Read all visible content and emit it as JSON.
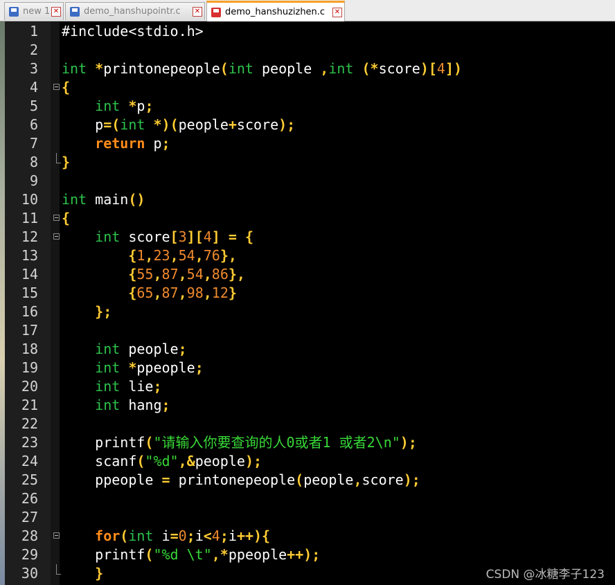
{
  "tabs": [
    {
      "label": "new 1",
      "icon": "save-disk-icon",
      "active": false
    },
    {
      "label": "demo_hanshupointr.c",
      "icon": "save-disk-icon",
      "active": false
    },
    {
      "label": "demo_hanshuzizhen.c",
      "icon": "save-disk-icon",
      "active": true
    }
  ],
  "editor": {
    "lines": [
      {
        "n": "1",
        "fold": "",
        "t": [
          [
            "pl",
            "#include<stdio.h>"
          ]
        ]
      },
      {
        "n": "2",
        "fold": "",
        "t": []
      },
      {
        "n": "3",
        "fold": "",
        "t": [
          [
            "kw",
            "int"
          ],
          [
            "pl",
            " "
          ],
          [
            "op",
            "*"
          ],
          [
            "pl",
            "printonepeople"
          ],
          [
            "op",
            "("
          ],
          [
            "kw",
            "int"
          ],
          [
            "pl",
            " people "
          ],
          [
            "op",
            ","
          ],
          [
            "kw",
            "int"
          ],
          [
            "pl",
            " "
          ],
          [
            "op",
            "(*"
          ],
          [
            "pl",
            "score"
          ],
          [
            "op",
            ")["
          ],
          [
            "num",
            "4"
          ],
          [
            "op",
            "])"
          ]
        ]
      },
      {
        "n": "4",
        "fold": "start",
        "t": [
          [
            "op",
            "{"
          ]
        ]
      },
      {
        "n": "5",
        "fold": "",
        "t": [
          [
            "pl",
            "    "
          ],
          [
            "kw",
            "int"
          ],
          [
            "pl",
            " "
          ],
          [
            "op",
            "*"
          ],
          [
            "pl",
            "p"
          ],
          [
            "op",
            ";"
          ]
        ]
      },
      {
        "n": "6",
        "fold": "",
        "t": [
          [
            "pl",
            "    p"
          ],
          [
            "op",
            "=("
          ],
          [
            "kw",
            "int"
          ],
          [
            "pl",
            " "
          ],
          [
            "op",
            "*)("
          ],
          [
            "pl",
            "people"
          ],
          [
            "op",
            "+"
          ],
          [
            "pl",
            "score"
          ],
          [
            "op",
            ");"
          ]
        ]
      },
      {
        "n": "7",
        "fold": "",
        "t": [
          [
            "pl",
            "    "
          ],
          [
            "ret",
            "return"
          ],
          [
            "pl",
            " p"
          ],
          [
            "op",
            ";"
          ]
        ]
      },
      {
        "n": "8",
        "fold": "end",
        "t": [
          [
            "op",
            "}"
          ]
        ]
      },
      {
        "n": "9",
        "fold": "",
        "t": []
      },
      {
        "n": "10",
        "fold": "",
        "t": [
          [
            "kw",
            "int"
          ],
          [
            "pl",
            " main"
          ],
          [
            "op",
            "()"
          ]
        ]
      },
      {
        "n": "11",
        "fold": "start",
        "t": [
          [
            "op",
            "{"
          ]
        ]
      },
      {
        "n": "12",
        "fold": "start",
        "t": [
          [
            "pl",
            "    "
          ],
          [
            "kw",
            "int"
          ],
          [
            "pl",
            " score"
          ],
          [
            "op",
            "["
          ],
          [
            "num",
            "3"
          ],
          [
            "op",
            "]["
          ],
          [
            "num",
            "4"
          ],
          [
            "op",
            "]"
          ],
          [
            "pl",
            " "
          ],
          [
            "op",
            "="
          ],
          [
            "pl",
            " "
          ],
          [
            "op",
            "{"
          ]
        ]
      },
      {
        "n": "13",
        "fold": "",
        "t": [
          [
            "pl",
            "        "
          ],
          [
            "op",
            "{"
          ],
          [
            "num",
            "1"
          ],
          [
            "op",
            ","
          ],
          [
            "num",
            "23"
          ],
          [
            "op",
            ","
          ],
          [
            "num",
            "54"
          ],
          [
            "op",
            ","
          ],
          [
            "num",
            "76"
          ],
          [
            "op",
            "},"
          ]
        ]
      },
      {
        "n": "14",
        "fold": "",
        "t": [
          [
            "pl",
            "        "
          ],
          [
            "op",
            "{"
          ],
          [
            "num",
            "55"
          ],
          [
            "op",
            ","
          ],
          [
            "num",
            "87"
          ],
          [
            "op",
            ","
          ],
          [
            "num",
            "54"
          ],
          [
            "op",
            ","
          ],
          [
            "num",
            "86"
          ],
          [
            "op",
            "},"
          ]
        ]
      },
      {
        "n": "15",
        "fold": "",
        "t": [
          [
            "pl",
            "        "
          ],
          [
            "op",
            "{"
          ],
          [
            "num",
            "65"
          ],
          [
            "op",
            ","
          ],
          [
            "num",
            "87"
          ],
          [
            "op",
            ","
          ],
          [
            "num",
            "98"
          ],
          [
            "op",
            ","
          ],
          [
            "num",
            "12"
          ],
          [
            "op",
            "}"
          ]
        ]
      },
      {
        "n": "16",
        "fold": "",
        "t": [
          [
            "pl",
            "    "
          ],
          [
            "op",
            "};"
          ]
        ]
      },
      {
        "n": "17",
        "fold": "",
        "t": []
      },
      {
        "n": "18",
        "fold": "",
        "t": [
          [
            "pl",
            "    "
          ],
          [
            "kw",
            "int"
          ],
          [
            "pl",
            " people"
          ],
          [
            "op",
            ";"
          ]
        ]
      },
      {
        "n": "19",
        "fold": "",
        "t": [
          [
            "pl",
            "    "
          ],
          [
            "kw",
            "int"
          ],
          [
            "pl",
            " "
          ],
          [
            "op",
            "*"
          ],
          [
            "pl",
            "ppeople"
          ],
          [
            "op",
            ";"
          ]
        ]
      },
      {
        "n": "20",
        "fold": "",
        "t": [
          [
            "pl",
            "    "
          ],
          [
            "kw",
            "int"
          ],
          [
            "pl",
            " lie"
          ],
          [
            "op",
            ";"
          ]
        ]
      },
      {
        "n": "21",
        "fold": "",
        "t": [
          [
            "pl",
            "    "
          ],
          [
            "kw",
            "int"
          ],
          [
            "pl",
            " hang"
          ],
          [
            "op",
            ";"
          ]
        ]
      },
      {
        "n": "22",
        "fold": "",
        "t": []
      },
      {
        "n": "23",
        "fold": "",
        "t": [
          [
            "pl",
            "    printf"
          ],
          [
            "op",
            "("
          ],
          [
            "str",
            "\"请输入你要查询的人0或者1 或者2\\n\""
          ],
          [
            "op",
            ");"
          ]
        ]
      },
      {
        "n": "24",
        "fold": "",
        "t": [
          [
            "pl",
            "    scanf"
          ],
          [
            "op",
            "("
          ],
          [
            "str",
            "\"%d\""
          ],
          [
            "op",
            ",&"
          ],
          [
            "pl",
            "people"
          ],
          [
            "op",
            ");"
          ]
        ]
      },
      {
        "n": "25",
        "fold": "",
        "t": [
          [
            "pl",
            "    ppeople "
          ],
          [
            "op",
            "="
          ],
          [
            "pl",
            " printonepeople"
          ],
          [
            "op",
            "("
          ],
          [
            "pl",
            "people"
          ],
          [
            "op",
            ","
          ],
          [
            "pl",
            "score"
          ],
          [
            "op",
            ");"
          ]
        ]
      },
      {
        "n": "26",
        "fold": "",
        "t": []
      },
      {
        "n": "27",
        "fold": "",
        "t": []
      },
      {
        "n": "28",
        "fold": "start",
        "t": [
          [
            "pl",
            "    "
          ],
          [
            "ret",
            "for"
          ],
          [
            "op",
            "("
          ],
          [
            "kw",
            "int"
          ],
          [
            "pl",
            " i"
          ],
          [
            "op",
            "="
          ],
          [
            "num",
            "0"
          ],
          [
            "op",
            ";"
          ],
          [
            "pl",
            "i"
          ],
          [
            "op",
            "<"
          ],
          [
            "num",
            "4"
          ],
          [
            "op",
            ";"
          ],
          [
            "pl",
            "i"
          ],
          [
            "op",
            "++){"
          ]
        ]
      },
      {
        "n": "29",
        "fold": "",
        "t": [
          [
            "pl",
            "    printf"
          ],
          [
            "op",
            "("
          ],
          [
            "str",
            "\"%d \\t\""
          ],
          [
            "op",
            ",*"
          ],
          [
            "pl",
            "ppeople"
          ],
          [
            "op",
            "++);"
          ]
        ]
      },
      {
        "n": "30",
        "fold": "end",
        "t": [
          [
            "pl",
            "    "
          ],
          [
            "op",
            "}"
          ]
        ]
      }
    ]
  },
  "watermark": "CSDN @冰糖李子123",
  "colors": {
    "keyword": "#2dc24c",
    "operator": "#ffcc33",
    "number": "#f08a2e",
    "string": "#38d838",
    "return": "#ff8c1a",
    "tab_accent": "#f7a028"
  }
}
